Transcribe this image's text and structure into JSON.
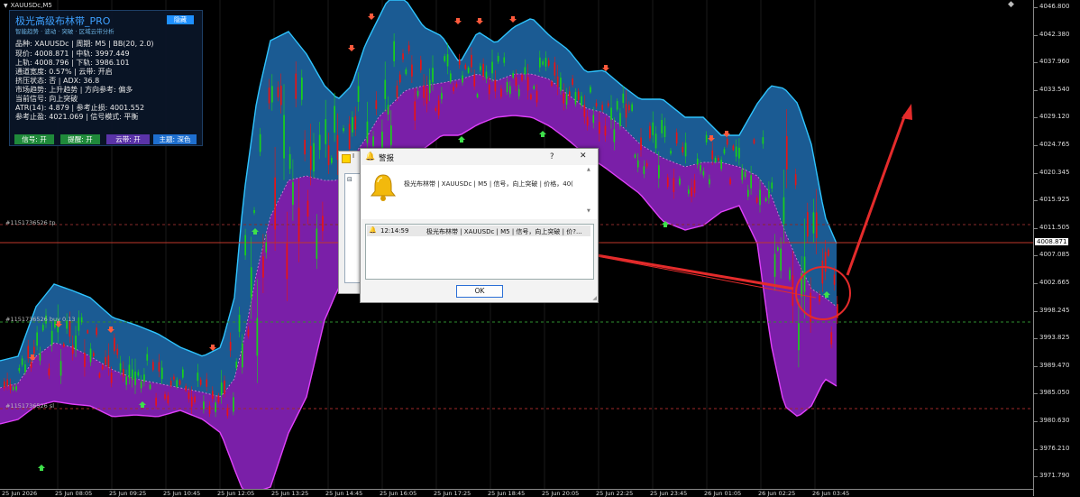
{
  "chart": {
    "symbol": "XAUUSDc,M5",
    "current_price": "4008.871",
    "price_ticks": [
      "4046.800",
      "4042.380",
      "4037.960",
      "4033.540",
      "4029.120",
      "4024.765",
      "4020.345",
      "4015.925",
      "4011.505",
      "4007.085",
      "4002.665",
      "3998.245",
      "3993.825",
      "3989.470",
      "3985.050",
      "3980.630",
      "3976.210",
      "3971.790"
    ],
    "time_ticks": [
      "25 Jun 2026",
      "25 Jun 08:05",
      "25 Jun 09:25",
      "25 Jun 10:45",
      "25 Jun 12:05",
      "25 Jun 13:25",
      "25 Jun 14:45",
      "25 Jun 16:05",
      "25 Jun 17:25",
      "25 Jun 18:45",
      "25 Jun 20:05",
      "25 Jun 22:25",
      "25 Jun 23:45",
      "26 Jun 01:05",
      "26 Jun 02:25",
      "26 Jun 03:45"
    ],
    "line_labels": {
      "tp": "#1151736526 tp",
      "buy": "#1151736526 buy 0.13",
      "sl": "#1151736526 sl"
    },
    "colors": {
      "upper_band": "#1b5b93",
      "lower_band": "#7a1fa8",
      "upper_line": "#2ec4ff",
      "lower_line": "#e040fb",
      "bull_candle": "#19d119",
      "bear_candle": "#e81414",
      "current_line": "#c0392b",
      "annotation": "#e42b2b"
    }
  },
  "panel": {
    "title": "极光高级布林带_PRO",
    "subtitle": "智能趋势 · 波动 · 突破 · 区域云带分析",
    "hide_button": "隐藏",
    "lines": [
      "品种: XAUUSDc  |  周期: M5  |  BB(20, 2.0)",
      "现价: 4008.871  |  中轨: 3997.449",
      "上轨: 4008.796  |  下轨: 3986.101",
      "通道宽度: 0.57%  |  云带: 开启",
      "挤压状态: 否  |  ADX: 36.8",
      "市场趋势: 上升趋势  |  方向参考: 偏多",
      "当前信号: 向上突破",
      "ATR(14): 4.879  |  参考止损: 4001.552",
      "参考止盈: 4021.069  |  信号模式: 平衡"
    ],
    "buttons": [
      {
        "label": "信号: 开",
        "color": "#1f8a3a"
      },
      {
        "label": "提醒: 开",
        "color": "#1f8a3a"
      },
      {
        "label": "云带: 开",
        "color": "#5a33a8"
      },
      {
        "label": "主题: 深色",
        "color": "#1e6fd0"
      }
    ]
  },
  "alert": {
    "title": "警报",
    "help": "?",
    "close": "✕",
    "message": "极光布林带 | XAUUSDc | M5 | 信号，向上突破 | 价格，40(",
    "list_time": "12:14:59",
    "list_message": "极光布林带 | XAUUSDc | M5 | 信号，向上突破 | 价?...",
    "ok": "OK"
  }
}
